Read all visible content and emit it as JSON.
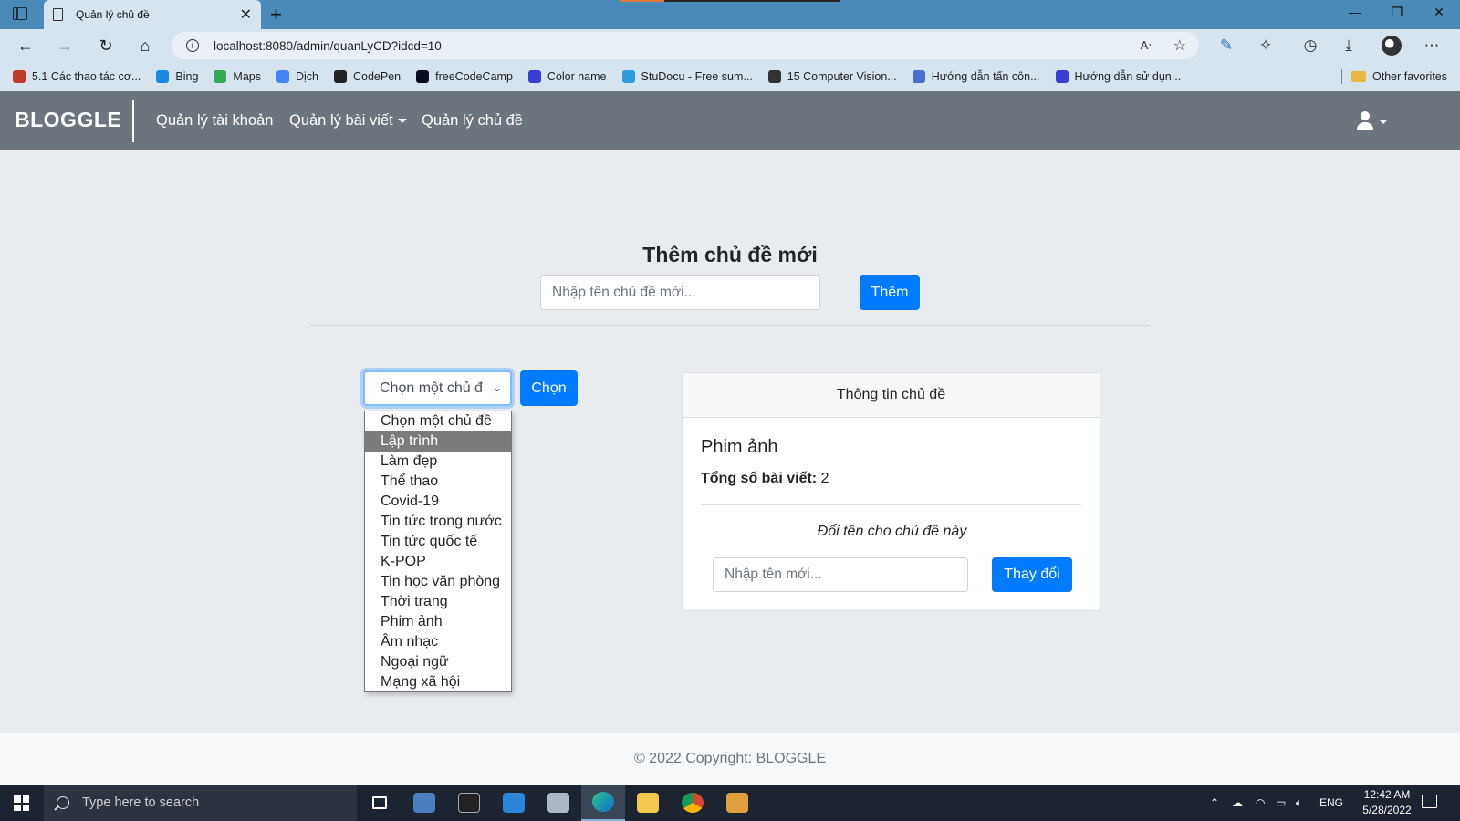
{
  "browser": {
    "tab_title": "Quản lý chủ đề",
    "tab_close": "✕",
    "new_tab": "+",
    "url": "localhost:8080/admin/quanLyCD?idcd=10",
    "read_aloud": "A)",
    "window_controls": {
      "minimize": "—",
      "restore": "❐",
      "close": "✕"
    },
    "bookmarks": [
      {
        "label": "5.1 Các thao tác cơ...",
        "icon": "hoc-icon",
        "color": "#c0392b"
      },
      {
        "label": "Bing",
        "icon": "bing-icon",
        "color": "#1e88e5"
      },
      {
        "label": "Maps",
        "icon": "maps-icon",
        "color": "#34a853"
      },
      {
        "label": "Dịch",
        "icon": "translate-icon",
        "color": "#4285f4"
      },
      {
        "label": "CodePen",
        "icon": "codepen-icon",
        "color": "#222222"
      },
      {
        "label": "freeCodeCamp",
        "icon": "freecodecamp-icon",
        "color": "#0a0a23"
      },
      {
        "label": "Color name",
        "icon": "color-name-icon",
        "color": "#3b3bd6"
      },
      {
        "label": "StuDocu - Free sum...",
        "icon": "studocu-icon",
        "color": "#2d9cdb"
      },
      {
        "label": "15 Computer Vision...",
        "icon": "analytics-icon",
        "color": "#333333"
      },
      {
        "label": "Hướng dẫn tấn côn...",
        "icon": "v-icon",
        "color": "#4a6fd1"
      },
      {
        "label": "Hướng dẫn sử dụn...",
        "icon": "guide-icon",
        "color": "#3b3bd6"
      }
    ],
    "other_favorites": "Other favorites"
  },
  "navbar": {
    "brand": "BLOGGLE",
    "links": [
      "Quản lý tài khoản",
      "Quản lý bài viết",
      "Quản lý chủ đề"
    ]
  },
  "add_topic": {
    "heading": "Thêm chủ đề mới",
    "placeholder": "Nhập tên chủ đề mới...",
    "button": "Thêm"
  },
  "topic_select": {
    "selected": "Chọn một chủ đ",
    "button": "Chọn",
    "highlighted_index": 1,
    "options": [
      "Chọn một chủ đề",
      "Lập trình",
      "Làm đẹp",
      "Thể thao",
      "Covid-19",
      "Tin tức trong nước",
      "Tin tức quốc tế",
      "K-POP",
      "Tin học văn phòng",
      "Thời trang",
      "Phim ảnh",
      "Âm nhạc",
      "Ngoại ngữ",
      "Mạng xã hội"
    ]
  },
  "topic_info": {
    "header": "Thông tin chủ đề",
    "name": "Phim ảnh",
    "count_label": "Tổng số bài viết:",
    "count_value": " 2",
    "rename_label": "Đổi tên cho chủ đề này",
    "rename_placeholder": "Nhập tên mới...",
    "rename_button": "Thay đổi"
  },
  "footer": {
    "text": "© 2022 Copyright: BLOGGLE"
  },
  "taskbar": {
    "search_placeholder": "Type here to search",
    "language": "ENG",
    "time": "12:42 AM",
    "date": "5/28/2022"
  },
  "colors": {
    "primary": "#007bff",
    "navbar": "#6c757d",
    "browser_chrome": "#d5e4ef",
    "titlebar": "#4a8ab8"
  }
}
